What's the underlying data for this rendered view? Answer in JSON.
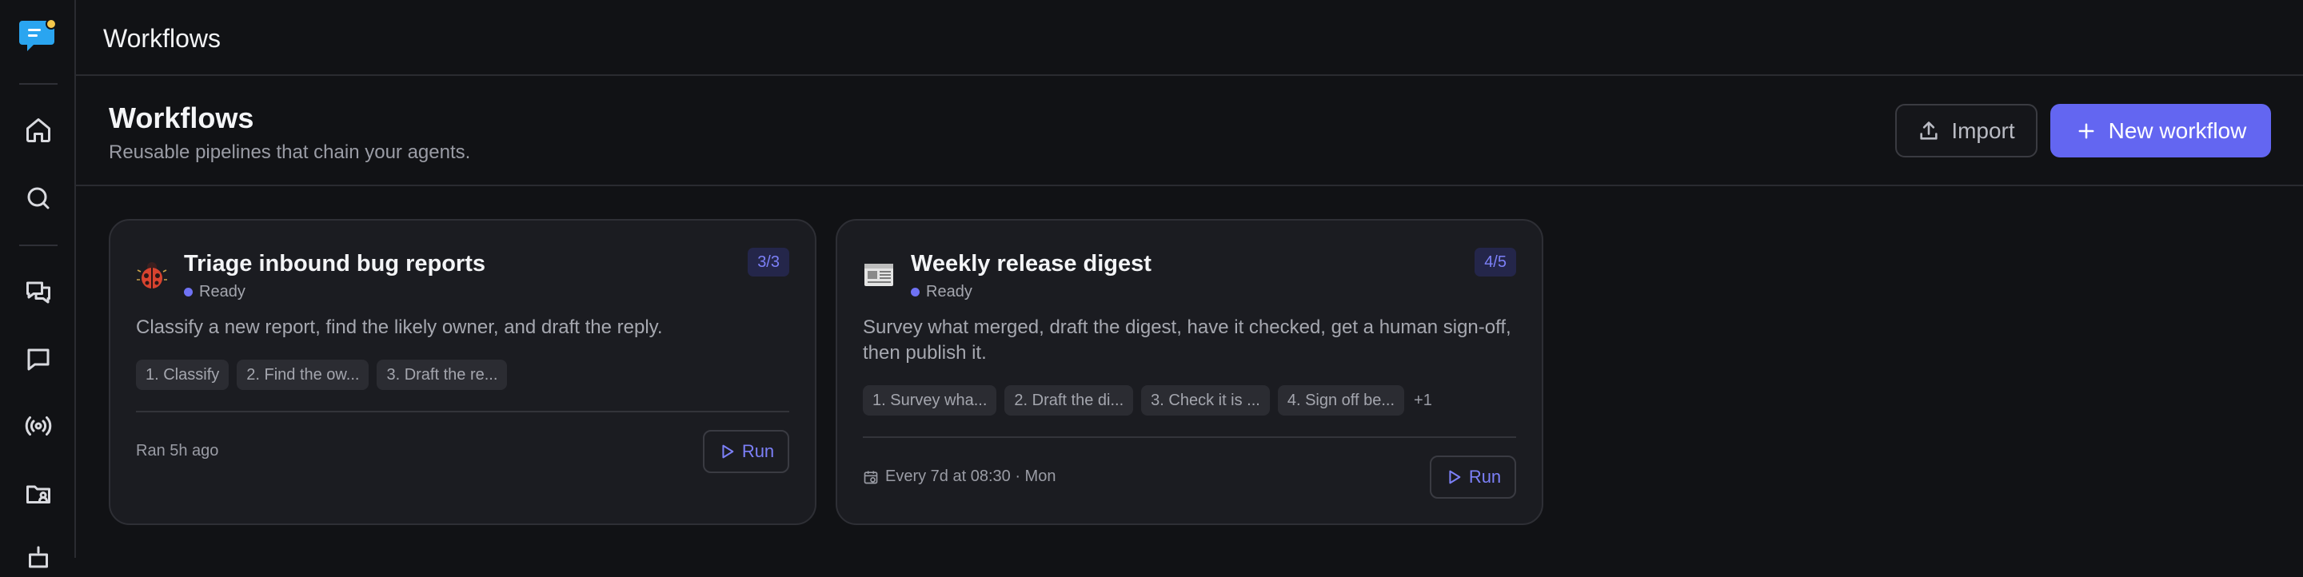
{
  "topbar": {
    "title": "Workflows"
  },
  "header": {
    "title": "Workflows",
    "subtitle": "Reusable pipelines that chain your agents.",
    "import_label": "Import",
    "new_label": "New workflow"
  },
  "rail": {
    "icons": [
      "chat-logo-icon",
      "home-icon",
      "search-icon",
      "conversations-icon",
      "message-icon",
      "broadcast-icon",
      "folder-user-icon",
      "robot-icon"
    ]
  },
  "workflows": [
    {
      "title": "Triage inbound bug reports",
      "status": "Ready",
      "count": "3/3",
      "description": "Classify a new report, find the likely owner, and draft the reply.",
      "steps": [
        "1. Classify",
        "2. Find the ow...",
        "3. Draft the re..."
      ],
      "more": "",
      "footer": "Ran 5h ago",
      "run_label": "Run",
      "emoji": "ladybug-icon"
    },
    {
      "title": "Weekly release digest",
      "status": "Ready",
      "count": "4/5",
      "description": "Survey what merged, draft the digest, have it checked, get a human sign-off, then publish it.",
      "steps": [
        "1. Survey wha...",
        "2. Draft the di...",
        "3. Check it is ...",
        "4. Sign off be..."
      ],
      "more": "+1",
      "footer": "Every 7d at 08:30 · Mon",
      "run_label": "Run",
      "emoji": "newspaper-icon"
    }
  ],
  "colors": {
    "accent": "#6366f1",
    "background": "#111215",
    "card": "#1b1c21"
  }
}
